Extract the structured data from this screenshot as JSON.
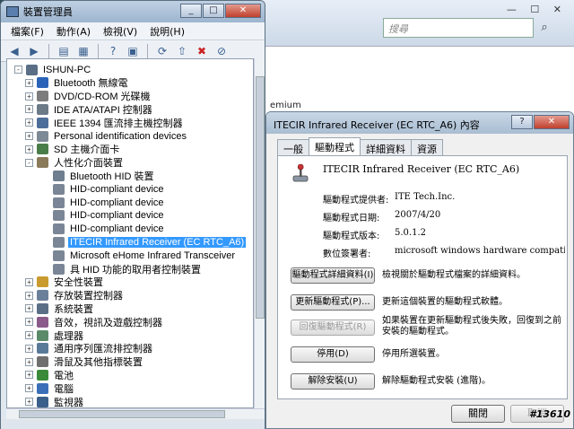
{
  "background_window": {
    "search_placeholder": "搜尋",
    "partial_text": "emium"
  },
  "device_manager": {
    "title": "裝置管理員",
    "menu": [
      "檔案(F)",
      "動作(A)",
      "檢視(V)",
      "說明(H)"
    ],
    "tree": [
      {
        "label": "ISHUN-PC",
        "level": 0,
        "expander": "-"
      },
      {
        "label": "Bluetooth 無線電",
        "level": 1,
        "expander": "+"
      },
      {
        "label": "DVD/CD-ROM 光碟機",
        "level": 1,
        "expander": "+"
      },
      {
        "label": "IDE ATA/ATAPI 控制器",
        "level": 1,
        "expander": "+"
      },
      {
        "label": "IEEE 1394 匯流排主機控制器",
        "level": 1,
        "expander": "+"
      },
      {
        "label": "Personal identification devices",
        "level": 1,
        "expander": "+"
      },
      {
        "label": "SD 主機介面卡",
        "level": 1,
        "expander": "+"
      },
      {
        "label": "人性化介面裝置",
        "level": 1,
        "expander": "-"
      },
      {
        "label": "Bluetooth HID 裝置",
        "level": 2,
        "expander": ""
      },
      {
        "label": "HID-compliant device",
        "level": 2,
        "expander": ""
      },
      {
        "label": "HID-compliant device",
        "level": 2,
        "expander": ""
      },
      {
        "label": "HID-compliant device",
        "level": 2,
        "expander": ""
      },
      {
        "label": "HID-compliant device",
        "level": 2,
        "expander": ""
      },
      {
        "label": "ITECIR Infrared Receiver (EC RTC_A6)",
        "level": 2,
        "expander": "",
        "selected": true
      },
      {
        "label": "Microsoft eHome Infrared Transceiver",
        "level": 2,
        "expander": ""
      },
      {
        "label": "具 HID 功能的取用者控制裝置",
        "level": 2,
        "expander": ""
      },
      {
        "label": "安全性裝置",
        "level": 1,
        "expander": "+"
      },
      {
        "label": "存放裝置控制器",
        "level": 1,
        "expander": "+"
      },
      {
        "label": "系統裝置",
        "level": 1,
        "expander": "+"
      },
      {
        "label": "音效，視訊及遊戲控制器",
        "level": 1,
        "expander": "+"
      },
      {
        "label": "處理器",
        "level": 1,
        "expander": "+"
      },
      {
        "label": "通用序列匯流排控制器",
        "level": 1,
        "expander": "+"
      },
      {
        "label": "滑鼠及其他指標裝置",
        "level": 1,
        "expander": "+"
      },
      {
        "label": "電池",
        "level": 1,
        "expander": "+"
      },
      {
        "label": "電腦",
        "level": 1,
        "expander": "+"
      },
      {
        "label": "監視器",
        "level": 1,
        "expander": "+"
      }
    ]
  },
  "properties_dialog": {
    "title": "ITECIR Infrared Receiver (EC RTC_A6) 內容",
    "tabs": [
      "一般",
      "驅動程式",
      "詳細資料",
      "資源"
    ],
    "active_tab": 1,
    "device_name": "ITECIR Infrared Receiver (EC RTC_A6)",
    "fields": [
      {
        "label": "驅動程式提供者:",
        "value": "ITE Tech.Inc."
      },
      {
        "label": "驅動程式日期:",
        "value": "2007/4/20"
      },
      {
        "label": "驅動程式版本:",
        "value": "5.0.1.2"
      },
      {
        "label": "數位簽署者:",
        "value": "microsoft windows hardware compatibility publi"
      }
    ],
    "buttons": [
      {
        "label": "驅動程式詳細資料(I)",
        "desc": "檢視關於驅動程式檔案的詳細資料。",
        "disabled": false
      },
      {
        "label": "更新驅動程式(P)...",
        "desc": "更新這個裝置的驅動程式軟體。",
        "disabled": false
      },
      {
        "label": "回復驅動程式(R)",
        "desc": "如果裝置在更新驅動程式後失敗，回復到之前安裝的驅動程式。",
        "disabled": true
      },
      {
        "label": "停用(D)",
        "desc": "停用所選裝置。",
        "disabled": false
      },
      {
        "label": "解除安裝(U)",
        "desc": "解除驅動程式安裝 (進階)。",
        "disabled": false
      }
    ],
    "ok_label": "關閉",
    "cancel_label": "取消"
  },
  "watermark": "#13610",
  "colors": {
    "selection": "#3399ff",
    "titlebar": "#a9bdd2"
  }
}
